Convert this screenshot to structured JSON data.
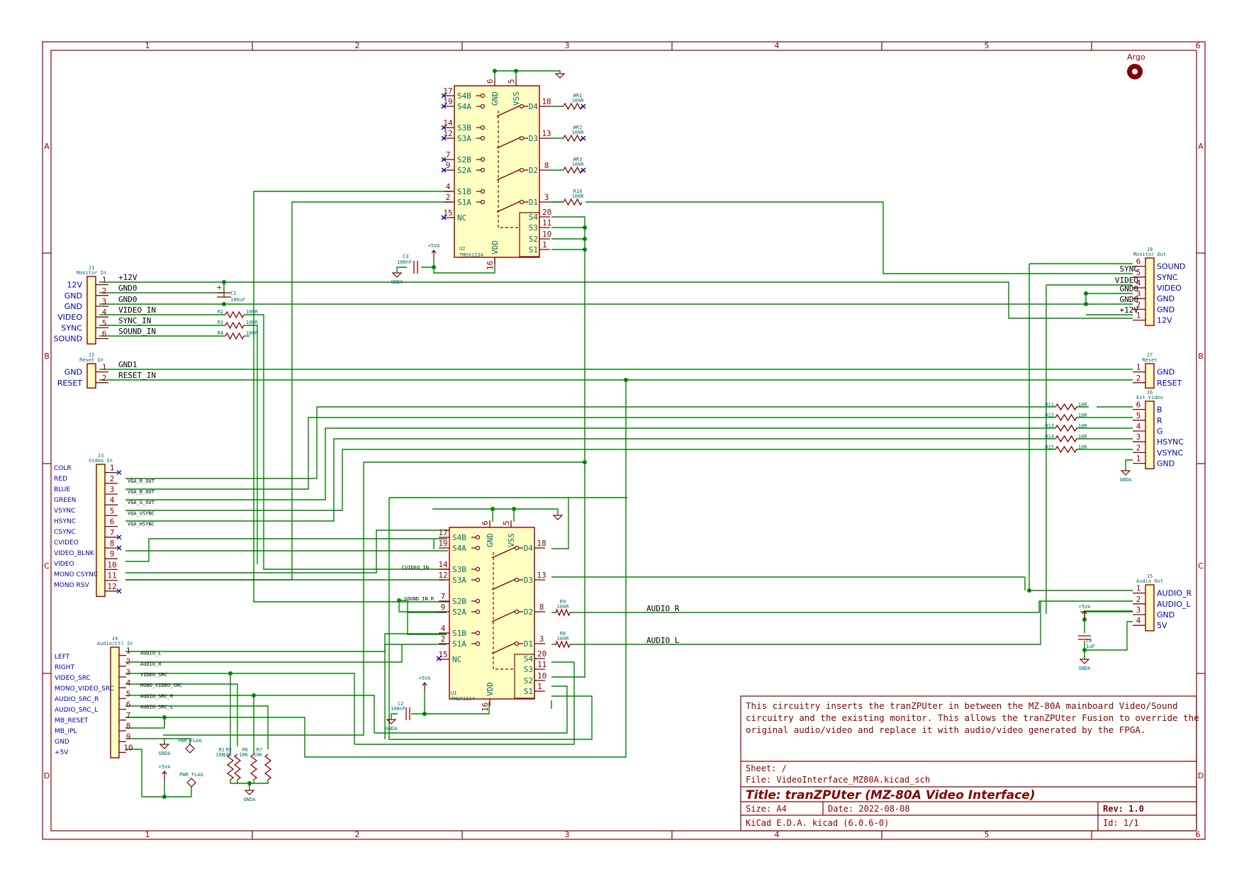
{
  "frame": {
    "columns": [
      "1",
      "2",
      "3",
      "4",
      "5",
      "6"
    ],
    "rows": [
      "A",
      "B",
      "C",
      "D"
    ]
  },
  "logo": {
    "label": "Argo"
  },
  "title_block": {
    "note_lines": [
      "This circuitry inserts the tranZPUter in between the MZ-80A mainboard Video/Sound",
      "circuitry and the existing monitor. This allows the tranZPUter Fusion to override the",
      "original audio/video and replace it with audio/video generated by the FPGA."
    ],
    "sheet": "Sheet: /",
    "file": "File: VideoInterface_MZ80A.kicad_sch",
    "title": "Title: tranZPUter (MZ-80A Video Interface)",
    "size": "Size: A4",
    "date": "Date: 2022-08-08",
    "rev": "Rev: 1.0",
    "tool": "KiCad E.D.A.  kicad (6.0.6-0)",
    "id": "Id: 1/1"
  },
  "u2": {
    "ref": "U2",
    "value": "TMUX1134",
    "left_pins": [
      {
        "name": "S4B",
        "num": "17"
      },
      {
        "name": "S4A",
        "num": "19"
      },
      {
        "name": "S3B",
        "num": "14"
      },
      {
        "name": "S3A",
        "num": "12"
      },
      {
        "name": "S2B",
        "num": "7"
      },
      {
        "name": "S2A",
        "num": "9"
      },
      {
        "name": "S1B",
        "num": "4"
      },
      {
        "name": "S1A",
        "num": "2"
      },
      {
        "name": "NC",
        "num": "15"
      }
    ],
    "right_pins": [
      {
        "name": "D4",
        "num": "18"
      },
      {
        "name": "D3",
        "num": "13"
      },
      {
        "name": "D2",
        "num": "8"
      },
      {
        "name": "D1",
        "num": "3"
      },
      {
        "name": "S4",
        "num": "20"
      },
      {
        "name": "S3",
        "num": "11"
      },
      {
        "name": "S2",
        "num": "10"
      },
      {
        "name": "S1",
        "num": "1"
      }
    ],
    "top_pins": [
      {
        "name": "GND",
        "num": "6"
      },
      {
        "name": "VSS",
        "num": "5"
      }
    ],
    "bottom_pin": {
      "name": "VDD",
      "num": "16"
    }
  },
  "u1": {
    "ref": "U1",
    "value": "TMUX1134",
    "left_pins": [
      {
        "name": "S4B",
        "num": "17"
      },
      {
        "name": "S4A",
        "num": "19"
      },
      {
        "name": "S3B",
        "num": "14"
      },
      {
        "name": "S3A",
        "num": "12"
      },
      {
        "name": "S2B",
        "num": "7"
      },
      {
        "name": "S2A",
        "num": "9"
      },
      {
        "name": "S1B",
        "num": "4"
      },
      {
        "name": "S1A",
        "num": "2"
      },
      {
        "name": "NC",
        "num": "15"
      }
    ],
    "right_pins": [
      {
        "name": "D4",
        "num": "18"
      },
      {
        "name": "D3",
        "num": "13"
      },
      {
        "name": "D2",
        "num": "8"
      },
      {
        "name": "D1",
        "num": "3"
      },
      {
        "name": "S4",
        "num": "20"
      },
      {
        "name": "S3",
        "num": "11"
      },
      {
        "name": "S2",
        "num": "10"
      },
      {
        "name": "S1",
        "num": "1"
      }
    ],
    "top_pins": [
      {
        "name": "GND",
        "num": "6"
      },
      {
        "name": "VSS",
        "num": "5"
      }
    ],
    "bottom_pin": {
      "name": "VDD",
      "num": "16"
    }
  },
  "u2_resistors": [
    {
      "ref": "#R1",
      "value": "100R"
    },
    {
      "ref": "#R2",
      "value": "100R"
    },
    {
      "ref": "#R3",
      "value": "100R"
    },
    {
      "ref": "R10",
      "value": "100R"
    }
  ],
  "u1_resistors": [
    {
      "ref": "R9",
      "value": "100R"
    },
    {
      "ref": "R8",
      "value": "100R"
    }
  ],
  "u1_nets": {
    "d2": "AUDIO_R",
    "d1": "AUDIO_L",
    "s3a": "CVIDEO_IN",
    "s2a": "SOUND_IN_R"
  },
  "caps": {
    "c3": {
      "ref": "C3",
      "value": "100nF"
    },
    "c1": {
      "ref": "C1",
      "value": "100uF",
      "plus": "+"
    },
    "c2": {
      "ref": "C2",
      "value": "100nF"
    },
    "c4": {
      "ref": "C4",
      "value": "1uF"
    }
  },
  "power": {
    "plus5va": "+5VA",
    "gnda": "GNDA",
    "pwr_flag": "PWR_FLAG"
  },
  "j1": {
    "ref": "J1",
    "value": "Monitor In",
    "pin_names": [
      "12V",
      "GND",
      "GND",
      "VIDEO",
      "SYNC",
      "SOUND"
    ],
    "pin_nums": [
      "1",
      "2",
      "3",
      "4",
      "5",
      "6"
    ],
    "nets": [
      "+12V",
      "GND0",
      "GND0",
      "VIDEO_IN",
      "SYNC_IN",
      "SOUND_IN"
    ],
    "resistors": [
      {
        "ref": "R2",
        "value": "100R"
      },
      {
        "ref": "R3",
        "value": "100R"
      },
      {
        "ref": "R4",
        "value": "100R"
      }
    ]
  },
  "j2": {
    "ref": "J2",
    "value": "Reset In",
    "pin_names": [
      "GND",
      "RESET"
    ],
    "pin_nums": [
      "1",
      "2"
    ],
    "nets": [
      "GND1",
      "RESET_IN"
    ]
  },
  "j8": {
    "ref": "J8",
    "value": "Monitor Out",
    "pin_names": [
      "SOUND",
      "SYNC",
      "VIDEO",
      "GND",
      "GND",
      "12V"
    ],
    "pin_nums": [
      "6",
      "5",
      "4",
      "3",
      "2",
      "1"
    ],
    "nets": [
      "SYNC",
      "VIDEO",
      "GND0",
      "GND0",
      "+12V"
    ]
  },
  "j7": {
    "ref": "J7",
    "value": "Reset",
    "pin_names": [
      "GND",
      "RESET"
    ],
    "pin_nums": [
      "1",
      "2"
    ]
  },
  "j6": {
    "ref": "J6",
    "value": "Ext Video",
    "pin_names": [
      "B",
      "R",
      "G",
      "HSYNC",
      "VSYNC",
      "GND"
    ],
    "pin_nums": [
      "6",
      "5",
      "4",
      "3",
      "2",
      "1"
    ],
    "resistors": [
      {
        "ref": "R11",
        "value": "10R"
      },
      {
        "ref": "R12",
        "value": "10R"
      },
      {
        "ref": "R13",
        "value": "10R"
      },
      {
        "ref": "R14",
        "value": "10R"
      },
      {
        "ref": "R15",
        "value": "10R"
      }
    ]
  },
  "j3": {
    "ref": "J3",
    "value": "Video In",
    "pin_names": [
      "COLR",
      "RED",
      "BLUE",
      "GREEN",
      "VSYNC",
      "HSYNC",
      "CSYNC",
      "CVIDEO",
      "VIDEO_BLNK",
      "VIDEO",
      "MONO CSYNC",
      "MONO RSV"
    ],
    "pin_nums": [
      "1",
      "2",
      "3",
      "4",
      "5",
      "6",
      "7",
      "8",
      "9",
      "10",
      "11",
      "12"
    ],
    "nets": [
      "",
      "VGA_R_OUT",
      "VGA_B_OUT",
      "VGA_G_OUT",
      "VGA_VSYNC",
      "VGA_HSYNC",
      "",
      "",
      "",
      "",
      "",
      ""
    ]
  },
  "j4": {
    "ref": "J4",
    "value": "Audio/Ctl In",
    "pin_names": [
      "LEFT",
      "RIGHT",
      "VIDEO_SRC",
      "MONO_VIDEO_SRC",
      "AUDIO_SRC_R",
      "AUDIO_SRC_L",
      "MB_RESET",
      "MB_IPL",
      "GND",
      "+5V"
    ],
    "pin_nums": [
      "1",
      "2",
      "3",
      "4",
      "5",
      "6",
      "7",
      "8",
      "9",
      "10"
    ],
    "nets": [
      "AUDIO_L",
      "AUDIO_R",
      "VIDEO_SRC",
      "MONO_VIDEO_SRC",
      "AUDIO_SRC_R",
      "AUDIO_SRC_L",
      "",
      "",
      "",
      ""
    ],
    "resistors": [
      {
        "ref": "R1",
        "value": "10K"
      },
      {
        "ref": "R5",
        "value": "10K"
      },
      {
        "ref": "R6",
        "value": "10K"
      },
      {
        "ref": "R7",
        "value": "10K"
      }
    ]
  },
  "j5": {
    "ref": "J5",
    "value": "Audio Out",
    "pin_names": [
      "AUDIO_R",
      "AUDIO_L",
      "GND",
      "5V"
    ],
    "pin_nums": [
      "1",
      "2",
      "3",
      "4"
    ]
  }
}
